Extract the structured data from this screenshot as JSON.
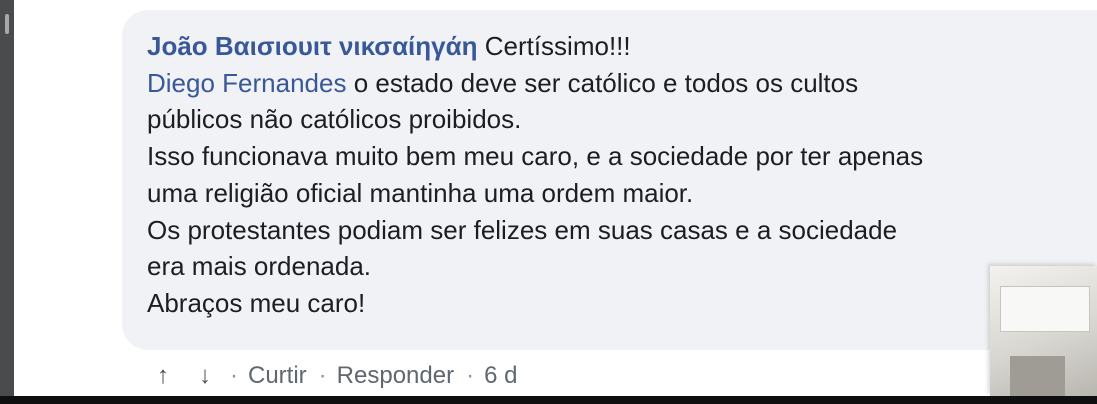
{
  "comment": {
    "author": "João Bαισιουιτ νικσαίηγάη",
    "first_line_text": "Certíssimo!!!",
    "mention": "Diego Fernandes",
    "mention_text": "o estado deve ser católico e todos os cultos",
    "lines": [
      "públicos não católicos proibidos.",
      "Isso funcionava muito bem meu caro, e a sociedade por ter apenas",
      "uma religião oficial mantinha uma ordem maior.",
      "Os protestantes podiam ser felizes em suas casas e a sociedade",
      "era mais ordenada.",
      "Abraços meu caro!"
    ]
  },
  "actions": {
    "upvote_icon": "↑",
    "downvote_icon": "↓",
    "separator": "·",
    "like_label": "Curtir",
    "reply_label": "Responder",
    "timestamp": "6 d"
  },
  "colors": {
    "author": "#385898",
    "bubble_bg": "#f1f2f5",
    "text": "#1c1e21",
    "meta": "#606770"
  }
}
